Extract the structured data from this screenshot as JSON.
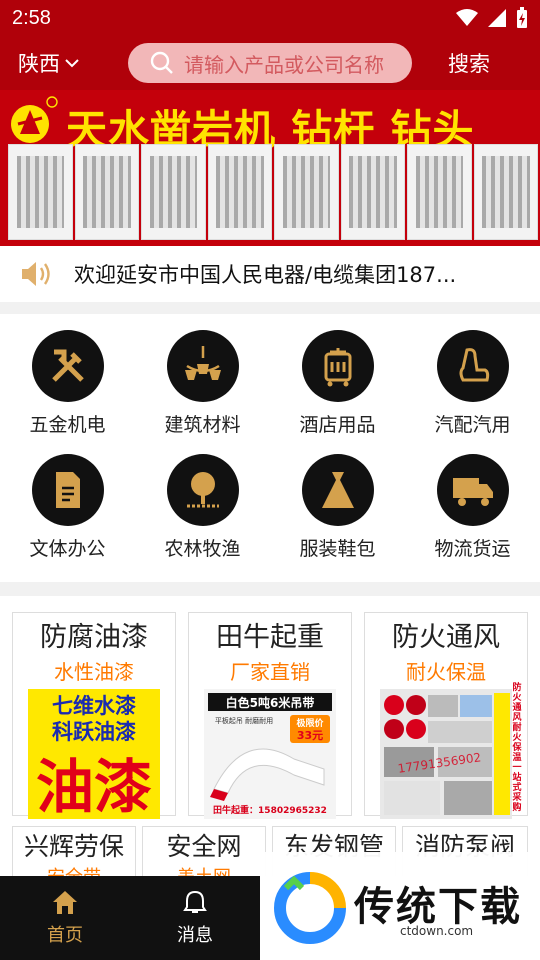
{
  "status": {
    "time": "2:58"
  },
  "header": {
    "region": "陕西",
    "search_placeholder": "请输入产品或公司名称",
    "search_button": "搜索"
  },
  "banner": {
    "title": "天水凿岩机 钻杆 钻头",
    "registered_mark": "®"
  },
  "notice": {
    "text": "欢迎延安市中国人民电器/电缆集团187..."
  },
  "categories": [
    {
      "label": "五金机电",
      "icon": "tools-icon"
    },
    {
      "label": "建筑材料",
      "icon": "chandelier-icon"
    },
    {
      "label": "酒店用品",
      "icon": "hotel-cart-icon"
    },
    {
      "label": "汽配汽用",
      "icon": "car-seat-icon"
    },
    {
      "label": "文体办公",
      "icon": "document-icon"
    },
    {
      "label": "农林牧渔",
      "icon": "tree-icon"
    },
    {
      "label": "服装鞋包",
      "icon": "dress-icon"
    },
    {
      "label": "物流货运",
      "icon": "truck-icon"
    }
  ],
  "ads": [
    {
      "title": "防腐油漆",
      "subtitle": "水性油漆",
      "img_lines": [
        "七维水漆",
        "科跃油漆",
        "油漆"
      ]
    },
    {
      "title": "田牛起重",
      "subtitle": "厂家直销",
      "img_lines": [
        "白色5吨6米吊带",
        "平板起吊 耐磨耐用",
        "极限价",
        "33元",
        "田牛起重：15802965232"
      ]
    },
    {
      "title": "防火通风",
      "subtitle": "耐火保温",
      "img_lines": [
        "防火通风耐火保温一站式采购",
        "17791356902"
      ]
    }
  ],
  "ads_row2": [
    {
      "title": "兴辉劳保",
      "subtitle": "安全带"
    },
    {
      "title": "安全网",
      "subtitle": "盖土网"
    },
    {
      "title": "东发钢管",
      "subtitle": ""
    },
    {
      "title": "消防泵阀",
      "subtitle": ""
    }
  ],
  "tabs": [
    {
      "label": "首页",
      "icon": "home-icon",
      "active": true
    },
    {
      "label": "消息",
      "icon": "bell-icon",
      "active": false
    }
  ],
  "watermark": {
    "name": "传统下载",
    "url": "ctdown.com"
  },
  "colors": {
    "brand_red": "#b0010a",
    "accent_gold": "#d4a14d",
    "accent_orange": "#ff7a00"
  }
}
